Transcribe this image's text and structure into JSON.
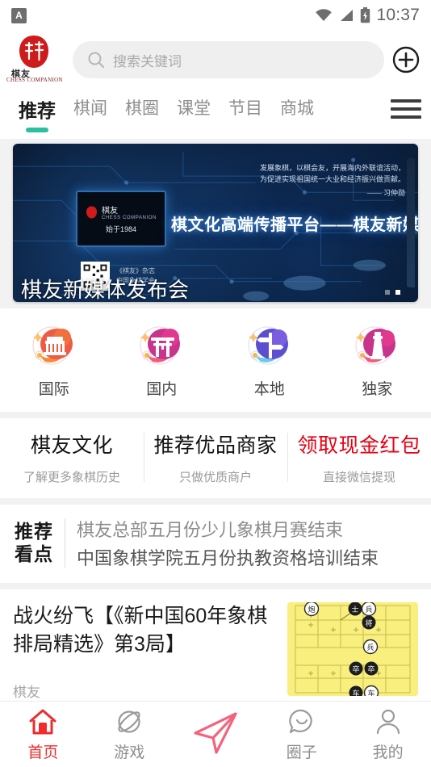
{
  "status_bar": {
    "app_icon_letter": "A",
    "time": "10:37",
    "icons": [
      "wifi-icon",
      "signal-icon",
      "battery-charging-icon"
    ]
  },
  "header": {
    "logo": {
      "name": "chess-companion-logo",
      "cn_text": "棋友",
      "en_text": "CHESS COMPANION"
    },
    "search": {
      "placeholder": "搜索关键词",
      "icon": "search-icon"
    },
    "add_button_icon": "plus-circle-icon"
  },
  "tabs": {
    "items": [
      {
        "label": "推荐",
        "active": true
      },
      {
        "label": "棋闻",
        "active": false
      },
      {
        "label": "棋圈",
        "active": false
      },
      {
        "label": "课堂",
        "active": false
      },
      {
        "label": "节目",
        "active": false
      },
      {
        "label": "商城",
        "active": false
      }
    ],
    "menu_icon": "hamburger-menu-icon",
    "active_underline_color": "#2cbfa1"
  },
  "banner": {
    "caption": "棋友新媒体发布会",
    "headline": "棋文化高端传播平台——棋友新媒体",
    "quote": "发展象棋，以棋会友，开展海内外联谊活动，\n为促进实现祖国统一大业和经济振兴做贡献。",
    "quote_author": "—— 习仲勋",
    "chip_brand": "棋友",
    "chip_brand_en": "CHESS COMPANION",
    "chip_year": "始于1984",
    "magazine_label": "《棋友》杂志\n中国象棋学会",
    "page_indicator": {
      "total": 2,
      "active_index": 1
    }
  },
  "categories": [
    {
      "label": "国际",
      "icon": "colosseum-icon",
      "color": "#f26b3a"
    },
    {
      "label": "国内",
      "icon": "torii-gate-icon",
      "color": "#e0398f"
    },
    {
      "label": "本地",
      "icon": "signpost-icon",
      "color": "#5b5bd6"
    },
    {
      "label": "独家",
      "icon": "lighthouse-icon",
      "color": "#d6337f"
    }
  ],
  "promos": [
    {
      "title": "棋友文化",
      "subtitle": "了解更多象棋历史",
      "color": "#111111"
    },
    {
      "title": "推荐优品商家",
      "subtitle": "只做优质商户",
      "color": "#111111"
    },
    {
      "title": "领取现金红包",
      "subtitle": "直接微信提现",
      "color": "#e60012"
    }
  ],
  "recommended": {
    "badge": "推荐\n看点",
    "items": [
      "棋友总部五月份少儿象棋月赛结束",
      "中国象棋学院五月份执教资格培训结束"
    ]
  },
  "article": {
    "title": "战火纷飞【《新中国60年象棋排局精选》第3局】",
    "source": "棋友",
    "thumbnail_icon": "xiangqi-board-thumbnail"
  },
  "bottom_nav": [
    {
      "label": "首页",
      "icon": "home-icon",
      "active": true
    },
    {
      "label": "游戏",
      "icon": "planet-icon",
      "active": false
    },
    {
      "label": "",
      "icon": "paper-plane-icon",
      "active": false
    },
    {
      "label": "圈子",
      "icon": "chat-bubble-icon",
      "active": false
    },
    {
      "label": "我的",
      "icon": "person-icon",
      "active": false
    }
  ]
}
